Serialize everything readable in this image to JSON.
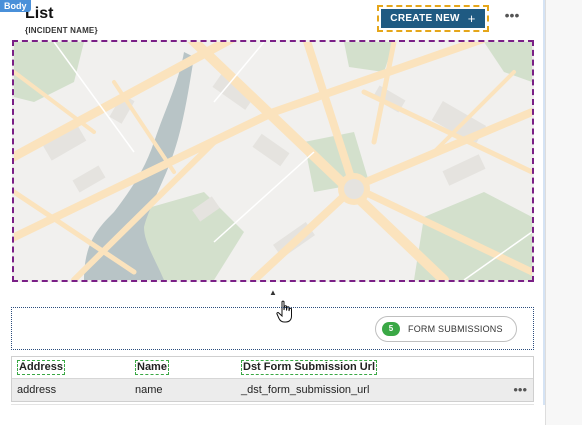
{
  "selection_tag": "Body",
  "header": {
    "title": "List",
    "subtitle": "{INCIDENT NAME}",
    "create_label": "CREATE NEW",
    "create_icon": "plus-icon",
    "more_icon": "more-horizontal-icon"
  },
  "map": {
    "icon": "map-placeholder",
    "colors": {
      "land": "#f1f0ee",
      "road": "#fbe3bd",
      "park": "#d3e0cc",
      "water": "#b8c4c6",
      "block": "#e5e3df"
    }
  },
  "form_submissions": {
    "count": "5",
    "label": "FORM SUBMISSIONS",
    "badge_color": "#3aa845"
  },
  "table": {
    "columns": [
      "Address",
      "Name",
      "Dst Form Submission Url"
    ],
    "rows": [
      [
        "address",
        "name",
        "_dst_form_submission_url"
      ]
    ]
  },
  "colors": {
    "primary_button": "#1f5a82",
    "selection_orange": "#e5a61a",
    "selection_purple": "#7a1f86"
  }
}
